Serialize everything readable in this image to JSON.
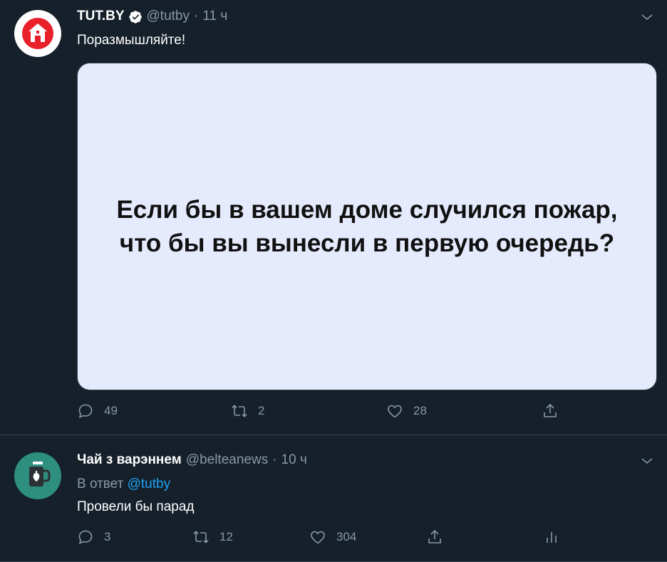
{
  "tweets": [
    {
      "author": {
        "name": "TUT.BY",
        "handle": "@tutby",
        "verified": true,
        "avatar_icon": "tutby-house-logo"
      },
      "time": "11 ч",
      "text": "Поразмышляйте!",
      "card_text": "Если бы в вашем доме случился пожар, что бы вы вынесли в первую очередь?",
      "actions": {
        "replies": "49",
        "retweets": "2",
        "likes": "28"
      }
    },
    {
      "author": {
        "name": "Чай з варэннем",
        "handle": "@belteanews",
        "verified": false,
        "avatar_icon": "tea-mug-logo"
      },
      "time": "10 ч",
      "reply_prefix": "В ответ",
      "reply_to": "@tutby",
      "text": "Провели бы парад",
      "actions": {
        "replies": "3",
        "retweets": "12",
        "likes": "304"
      }
    }
  ],
  "separator": "·",
  "colors": {
    "background": "#15202b",
    "secondary_text": "#8899a6",
    "link": "#1da1f2",
    "card_bg": "#e6eafd",
    "tutby_red": "#e8202a",
    "tea_green": "#2f8f7e"
  }
}
